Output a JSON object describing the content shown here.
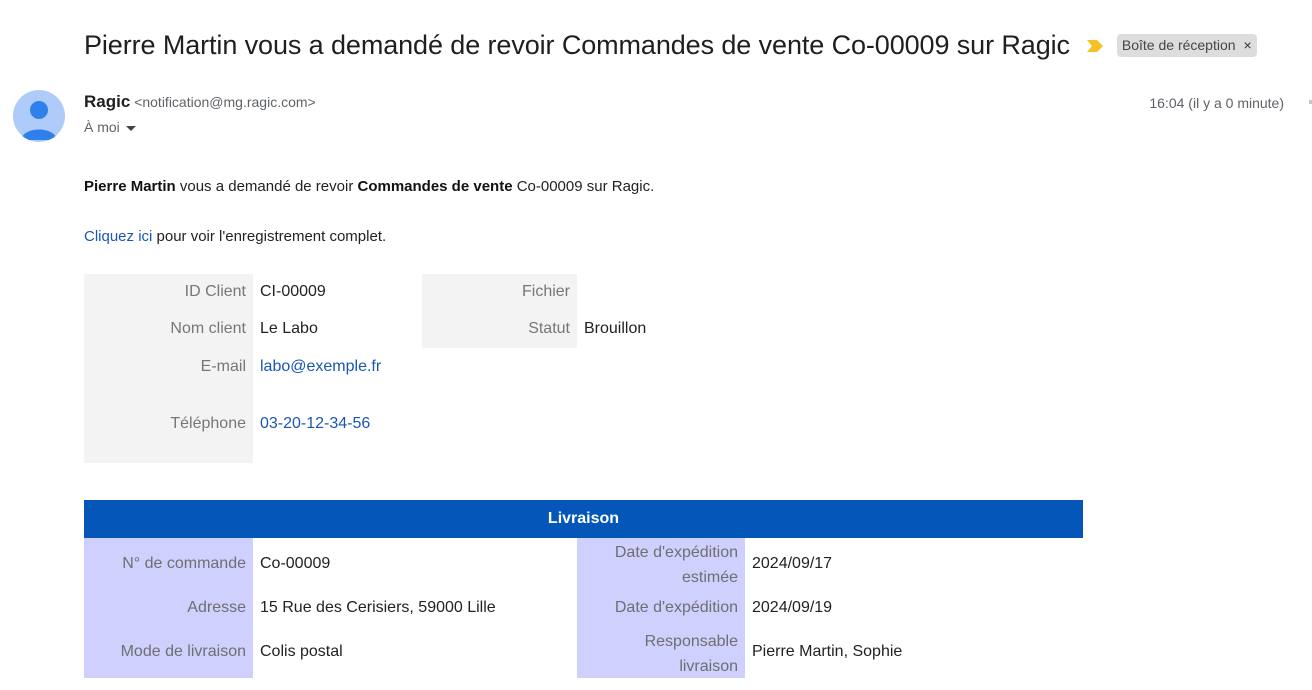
{
  "subject": "Pierre Martin vous a demandé de revoir Commandes de vente Co-00009 sur Ragic",
  "labels": {
    "inbox": "Boîte de réception",
    "close": "×"
  },
  "sender": {
    "name": "Ragic",
    "email": "<notification@mg.ragic.com>",
    "to": "À moi",
    "time": "16:04 (il y a 0 minute)"
  },
  "message": {
    "line1": {
      "who": "Pierre Martin",
      "text1": " vous a demandé de revoir ",
      "what": "Commandes de vente",
      "text2": " Co-00009 sur Ragic."
    },
    "line2": {
      "link": "Cliquez ici",
      "text": " pour voir l'enregistrement complet."
    }
  },
  "record": {
    "id_client": {
      "label": "ID Client",
      "value": "CI-00009"
    },
    "nom_client": {
      "label": "Nom client",
      "value": "Le Labo"
    },
    "email": {
      "label": "E-mail",
      "value": "labo@exemple.fr"
    },
    "telephone": {
      "label": "Téléphone",
      "value": "03-20-12-34-56"
    },
    "fichier": {
      "label": "Fichier",
      "value": ""
    },
    "statut": {
      "label": "Statut",
      "value": "Brouillon"
    }
  },
  "livraison": {
    "title": "Livraison",
    "commande": {
      "label": "N° de commande",
      "value": "Co-00009"
    },
    "adresse": {
      "label": "Adresse",
      "value": "15 Rue des Cerisiers, 59000 Lille"
    },
    "mode": {
      "label": "Mode de livraison",
      "value": "Colis postal"
    },
    "date_estimee": {
      "label_line1": "Date d'expédition",
      "label_line2": "estimée",
      "value": "2024/09/17"
    },
    "date_expedition": {
      "label": "Date d'expédition",
      "value": "2024/09/19"
    },
    "responsable": {
      "label_line1": "Responsable",
      "label_line2": "livraison",
      "value": "Pierre Martin, Sophie"
    }
  },
  "colors": {
    "link": "#1a57b3",
    "header": "#0456b9",
    "label_bg": "#f3f3f3",
    "livraison_label_bg": "#cfd0fd",
    "importance": "#f6c026"
  }
}
